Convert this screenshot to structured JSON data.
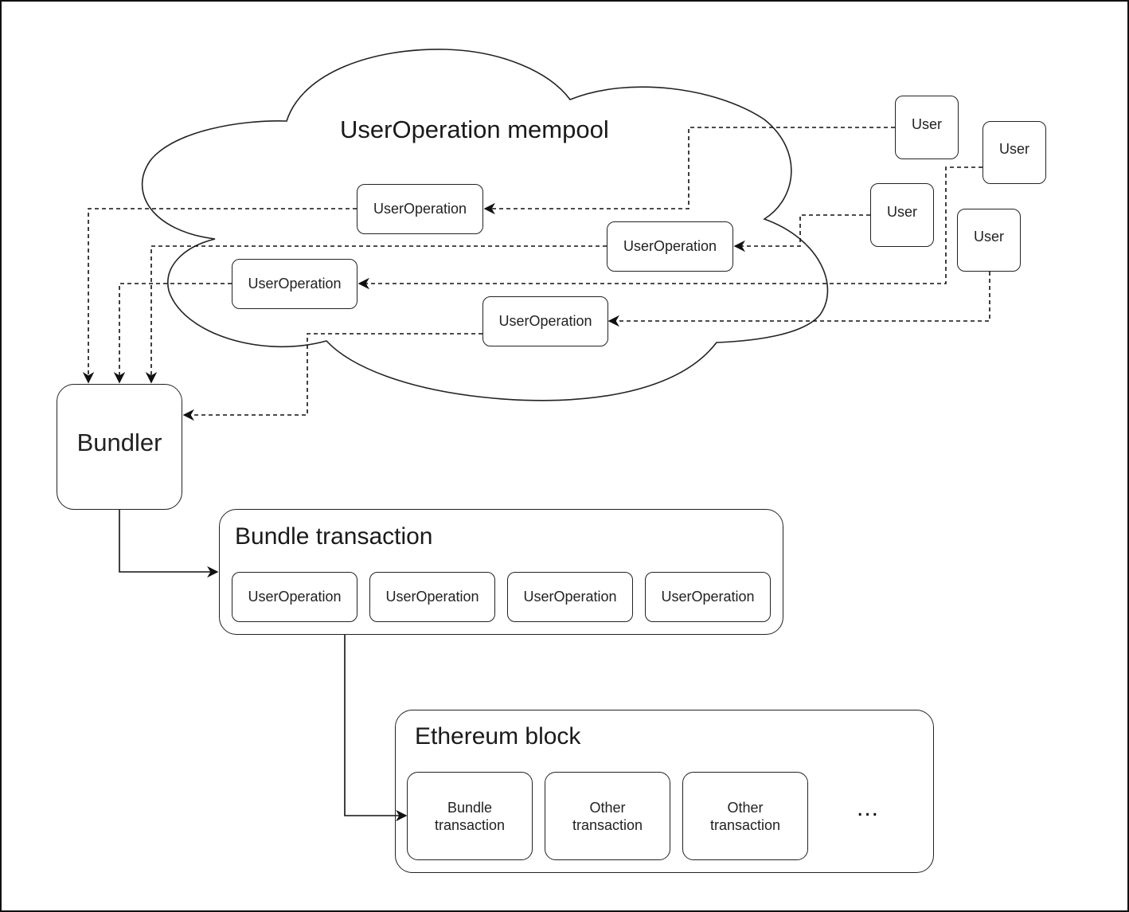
{
  "mempool": {
    "title": "UserOperation mempool",
    "user_operations": [
      "UserOperation",
      "UserOperation",
      "UserOperation",
      "UserOperation"
    ]
  },
  "users": [
    "User",
    "User",
    "User",
    "User"
  ],
  "bundler": {
    "label": "Bundler"
  },
  "bundle_transaction": {
    "title": "Bundle transaction",
    "user_operations": [
      "UserOperation",
      "UserOperation",
      "UserOperation",
      "UserOperation"
    ]
  },
  "ethereum_block": {
    "title": "Ethereum block",
    "transactions": [
      {
        "line1": "Bundle",
        "line2": "transaction"
      },
      {
        "line1": "Other",
        "line2": "transaction"
      },
      {
        "line1": "Other",
        "line2": "transaction"
      }
    ],
    "more": "..."
  },
  "colors": {
    "stroke": "#222222",
    "background": "#ffffff"
  }
}
